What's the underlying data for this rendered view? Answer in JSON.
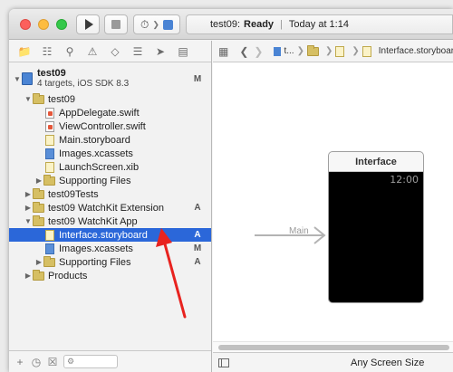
{
  "toolbar": {
    "run_icon": "play-icon",
    "stop_icon": "stop-icon",
    "scheme_icons": [
      "watch-icon",
      "chevron-right-icon",
      "app-icon"
    ]
  },
  "status": {
    "project": "test09:",
    "state": "Ready",
    "separator": "|",
    "time": "Today at 1:14"
  },
  "navigator": {
    "tabs": [
      "folder-icon",
      "hierarchy-icon",
      "search-icon",
      "warning-icon",
      "test-icon",
      "debug-icon",
      "breakpoint-icon",
      "report-icon"
    ],
    "tree": [
      {
        "label": "test09",
        "subtitle": "4 targets, iOS SDK 8.3",
        "badge": "M",
        "kind": "project"
      },
      {
        "label": "test09",
        "badge": "",
        "kind": "group"
      },
      {
        "label": "AppDelegate.swift",
        "badge": "",
        "kind": "swift"
      },
      {
        "label": "ViewController.swift",
        "badge": "",
        "kind": "swift"
      },
      {
        "label": "Main.storyboard",
        "badge": "",
        "kind": "storyboard"
      },
      {
        "label": "Images.xcassets",
        "badge": "",
        "kind": "xcassets"
      },
      {
        "label": "LaunchScreen.xib",
        "badge": "",
        "kind": "xib"
      },
      {
        "label": "Supporting Files",
        "badge": "",
        "kind": "group"
      },
      {
        "label": "test09Tests",
        "badge": "",
        "kind": "group"
      },
      {
        "label": "test09 WatchKit Extension",
        "badge": "A",
        "kind": "group"
      },
      {
        "label": "test09 WatchKit App",
        "badge": "",
        "kind": "group"
      },
      {
        "label": "Interface.storyboard",
        "badge": "A",
        "kind": "storyboard"
      },
      {
        "label": "Images.xcassets",
        "badge": "M",
        "kind": "xcassets"
      },
      {
        "label": "Supporting Files",
        "badge": "A",
        "kind": "group"
      },
      {
        "label": "Products",
        "badge": "",
        "kind": "group"
      }
    ],
    "footer": {
      "add_icon": "plus-icon",
      "recent_icon": "clock-icon",
      "scm_icon": "scm-icon",
      "filter_icon": "filter-icon"
    }
  },
  "jumpbar": {
    "crumbs": [
      "t...",
      "Interface.storyboard"
    ]
  },
  "canvas": {
    "entry_label": "Main",
    "scene_title": "Interface",
    "watch_time": "12:00"
  },
  "editor_footer": {
    "size_class": "Any Screen Size"
  },
  "colors": {
    "selection": "#2b67d9",
    "annotation_arrow": "#e8231f"
  }
}
